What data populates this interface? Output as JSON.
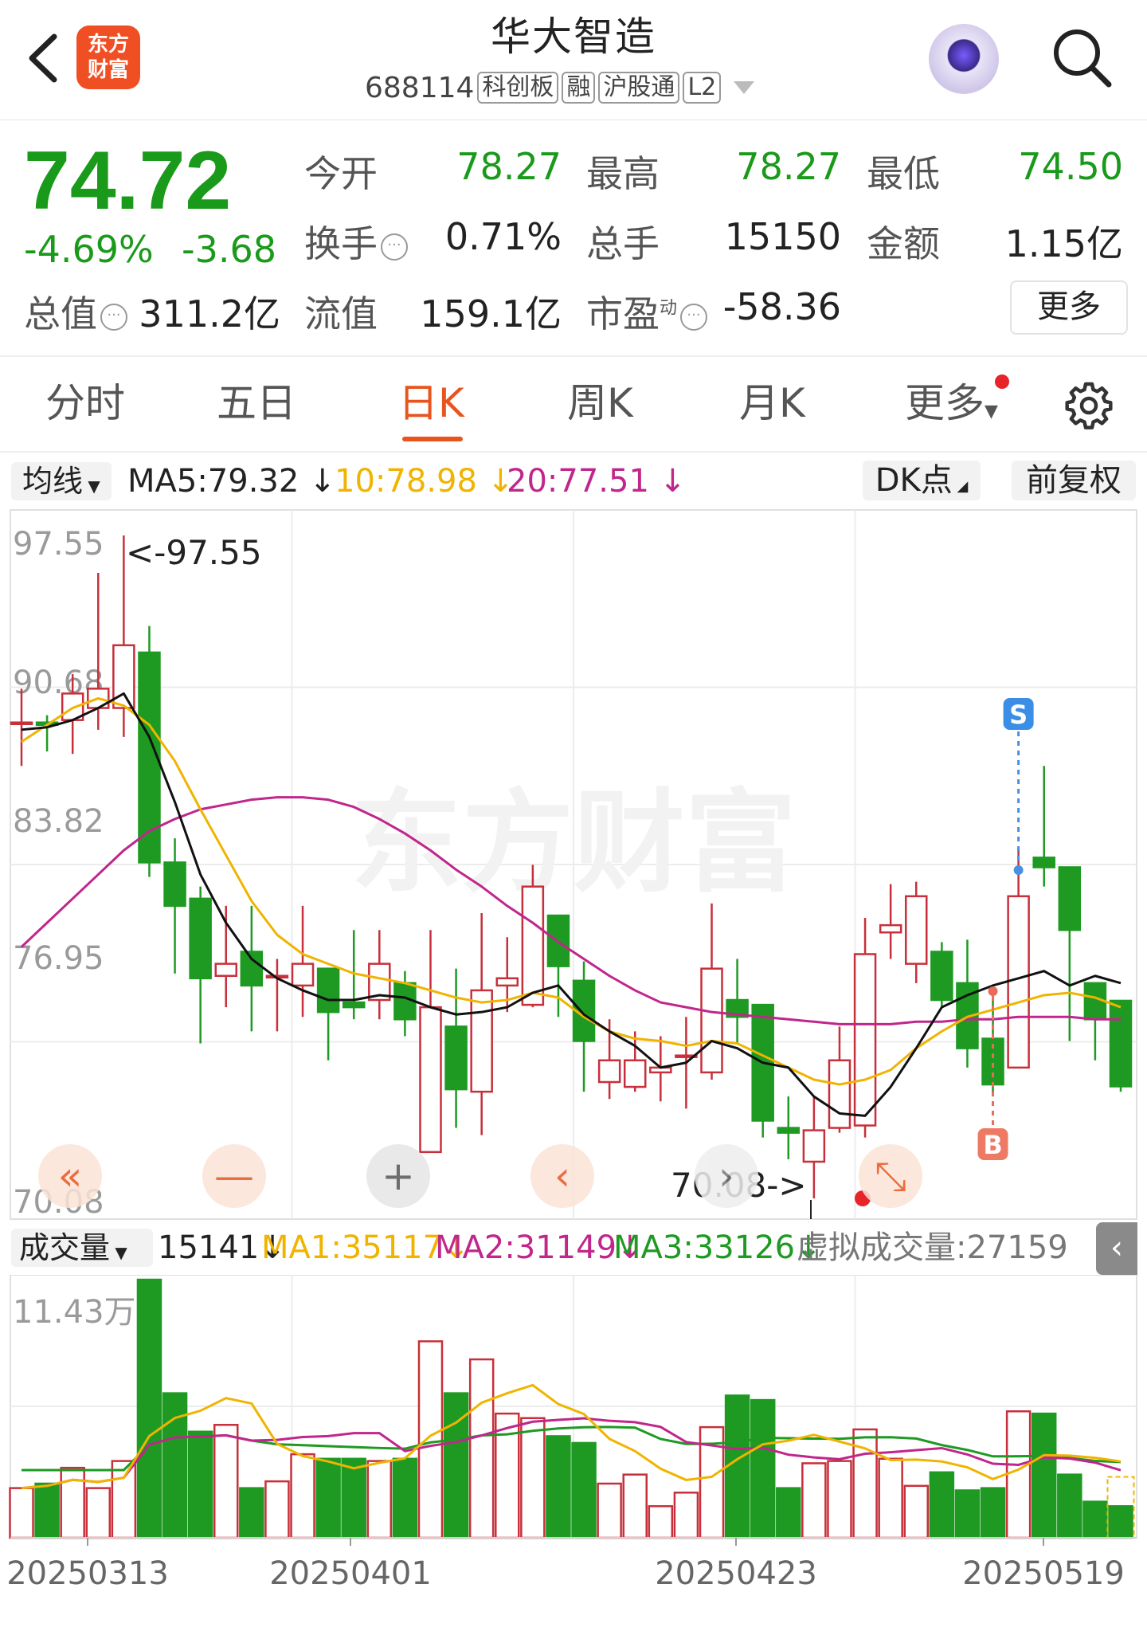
{
  "header": {
    "back_icon": "chevron-left-icon",
    "logo_text": "东方\n财富",
    "stock_name": "华大智造",
    "stock_code": "688114",
    "tags": [
      "科创板",
      "融",
      "沪股通",
      "L2"
    ],
    "assistant_icon": "robot-icon",
    "search_icon": "search-icon"
  },
  "quote": {
    "price": "74.72",
    "change_pct": "-4.69%",
    "change": "-3.68",
    "fields": [
      {
        "label": "今开",
        "value": "78.27",
        "color": "green"
      },
      {
        "label": "最高",
        "value": "78.27",
        "color": "green"
      },
      {
        "label": "最低",
        "value": "74.50",
        "color": "green"
      },
      {
        "label": "换手",
        "value": "0.71%",
        "color": "dark",
        "info": true
      },
      {
        "label": "总手",
        "value": "15150",
        "color": "dark"
      },
      {
        "label": "金额",
        "value": "1.15亿",
        "color": "dark"
      },
      {
        "label": "总值",
        "value": "311.2亿",
        "color": "dark",
        "info": true
      },
      {
        "label": "流值",
        "value": "159.1亿",
        "color": "dark"
      },
      {
        "label": "市盈",
        "label_sup": "动",
        "value": "-58.36",
        "color": "dark",
        "info": true
      }
    ],
    "more_label": "更多"
  },
  "tabs": [
    {
      "label": "分时"
    },
    {
      "label": "五日"
    },
    {
      "label": "日K",
      "active": true
    },
    {
      "label": "周K"
    },
    {
      "label": "月K"
    },
    {
      "label": "更多"
    }
  ],
  "kline_header": {
    "select": "均线",
    "ma5": "MA5:79.32",
    "ma10": "10:78.98",
    "ma20": "20:77.51",
    "dk_label": "DK点",
    "adjust_label": "前复权"
  },
  "volume_header": {
    "select": "成交量",
    "vol": "15141",
    "ma1": "MA1:35117",
    "ma2": "MA2:31149",
    "ma3": "MA3:33126",
    "virtual": "虚拟成交量:27159",
    "max_label": "11.43万"
  },
  "colors": {
    "up": "#c7303a",
    "down": "#1e9a22",
    "ma5": "#111111",
    "ma10": "#f0b400",
    "ma20": "#c0268c",
    "accent": "#e8541e"
  },
  "chart_data": {
    "type": "candlestick",
    "y_ticks": [
      "97.55",
      "90.68",
      "83.82",
      "76.95",
      "70.08"
    ],
    "ylim": [
      70.08,
      97.55
    ],
    "high_label": "<-97.55",
    "low_label": "70.08->",
    "watermark": "东方财富",
    "x_labels": [
      "20250313",
      "20250401",
      "20250423",
      "20250519"
    ],
    "markers": {
      "sell": "S",
      "buy": "B"
    },
    "candles": [
      [
        89.8,
        89.8,
        91.2,
        88.0,
        0.22
      ],
      [
        89.8,
        89.7,
        90.1,
        88.6,
        0.24
      ],
      [
        89.9,
        91.0,
        91.8,
        88.5,
        0.31
      ],
      [
        90.4,
        91.2,
        96.0,
        89.5,
        0.22
      ],
      [
        90.4,
        93.0,
        97.55,
        89.2,
        0.34
      ],
      [
        92.7,
        84.0,
        93.8,
        83.4,
        1.143
      ],
      [
        84.0,
        82.2,
        85.0,
        79.4,
        0.64
      ],
      [
        82.5,
        79.2,
        83.0,
        76.5,
        0.47
      ],
      [
        79.3,
        79.8,
        82.2,
        78.0,
        0.5
      ],
      [
        80.3,
        78.9,
        82.2,
        77.0,
        0.22
      ],
      [
        79.3,
        79.3,
        80.0,
        77.0,
        0.25
      ],
      [
        78.9,
        79.8,
        82.2,
        77.6,
        0.37
      ],
      [
        79.6,
        77.8,
        79.6,
        75.8,
        0.35
      ],
      [
        78.2,
        78.0,
        81.2,
        77.5,
        0.35
      ],
      [
        78.3,
        79.8,
        81.2,
        77.5,
        0.34
      ],
      [
        79.0,
        77.5,
        79.5,
        76.8,
        0.35
      ],
      [
        72.0,
        78.0,
        81.2,
        72.0,
        0.87
      ],
      [
        77.2,
        74.6,
        79.6,
        73.0,
        0.64
      ],
      [
        74.5,
        78.7,
        81.9,
        72.7,
        0.79
      ],
      [
        78.9,
        79.2,
        80.9,
        77.8,
        0.55
      ],
      [
        78.1,
        83.0,
        83.9,
        78.0,
        0.53
      ],
      [
        81.8,
        79.7,
        81.8,
        77.6,
        0.45
      ],
      [
        79.1,
        76.6,
        79.9,
        74.5,
        0.42
      ],
      [
        74.9,
        75.8,
        77.5,
        74.2,
        0.24
      ],
      [
        74.7,
        75.8,
        77.0,
        74.5,
        0.28
      ],
      [
        75.3,
        75.5,
        76.8,
        74.1,
        0.14
      ],
      [
        76.0,
        76.0,
        77.6,
        73.8,
        0.2
      ],
      [
        75.3,
        79.6,
        82.3,
        75.0,
        0.49
      ],
      [
        78.3,
        77.6,
        80.0,
        76.5,
        0.63
      ],
      [
        78.1,
        73.3,
        78.1,
        72.6,
        0.61
      ],
      [
        73.0,
        72.8,
        74.3,
        71.7,
        0.22
      ],
      [
        71.6,
        72.9,
        74.3,
        70.08,
        0.33
      ],
      [
        73.0,
        75.8,
        77.2,
        72.8,
        0.34
      ],
      [
        73.1,
        80.2,
        81.7,
        72.6,
        0.48
      ],
      [
        81.1,
        81.4,
        83.1,
        80.0,
        0.35
      ],
      [
        79.8,
        82.6,
        83.2,
        79.0,
        0.23
      ],
      [
        80.3,
        78.3,
        80.7,
        78.0,
        0.29
      ],
      [
        79.0,
        76.3,
        80.8,
        75.5,
        0.21
      ],
      [
        76.7,
        74.8,
        78.3,
        74.3,
        0.22
      ],
      [
        75.5,
        82.6,
        84.6,
        75.5,
        0.56
      ],
      [
        84.2,
        83.8,
        88.0,
        83.0,
        0.55
      ],
      [
        83.8,
        81.2,
        83.8,
        76.6,
        0.28
      ],
      [
        79.0,
        77.5,
        79.0,
        75.8,
        0.16
      ],
      [
        78.27,
        74.72,
        78.27,
        74.5,
        0.14
      ]
    ],
    "ma5": [
      89.5,
      89.6,
      89.9,
      90.4,
      91.0,
      89.2,
      86.5,
      83.5,
      81.5,
      80.0,
      79.2,
      78.7,
      78.3,
      78.3,
      78.5,
      78.4,
      78.0,
      77.7,
      77.8,
      78.0,
      78.6,
      78.9,
      77.7,
      77.0,
      76.4,
      75.5,
      75.7,
      76.6,
      76.3,
      75.7,
      75.5,
      74.3,
      73.6,
      73.5,
      74.7,
      76.3,
      78.0,
      78.5,
      78.9,
      79.2,
      79.5,
      78.9,
      79.3,
      79.0
    ],
    "ma10": [
      89.0,
      89.7,
      90.4,
      90.8,
      90.5,
      89.7,
      88.2,
      86.2,
      84.3,
      82.4,
      81.0,
      80.2,
      79.8,
      79.4,
      79.2,
      79.0,
      78.7,
      78.4,
      78.2,
      78.3,
      78.6,
      78.4,
      77.6,
      77.0,
      76.7,
      76.6,
      76.4,
      76.6,
      76.5,
      76.0,
      75.5,
      75.0,
      74.8,
      75.0,
      75.4,
      76.3,
      77.0,
      77.6,
      77.9,
      78.2,
      78.5,
      78.6,
      78.4,
      78.0
    ],
    "ma20": [
      80.5,
      81.5,
      82.5,
      83.5,
      84.5,
      85.3,
      85.8,
      86.2,
      86.4,
      86.6,
      86.7,
      86.7,
      86.6,
      86.3,
      85.8,
      85.2,
      84.5,
      83.7,
      83.0,
      82.2,
      81.5,
      80.7,
      80.0,
      79.3,
      78.7,
      78.2,
      78.0,
      77.8,
      77.7,
      77.6,
      77.5,
      77.4,
      77.3,
      77.3,
      77.3,
      77.4,
      77.4,
      77.5,
      77.5,
      77.6,
      77.6,
      77.6,
      77.5,
      77.5
    ]
  },
  "controls": [
    {
      "icon": "double-left-icon"
    },
    {
      "icon": "zoom-out-icon"
    },
    {
      "icon": "zoom-in-icon"
    },
    {
      "icon": "prev-icon"
    },
    {
      "icon": "next-icon"
    },
    {
      "icon": "fullscreen-icon"
    }
  ]
}
